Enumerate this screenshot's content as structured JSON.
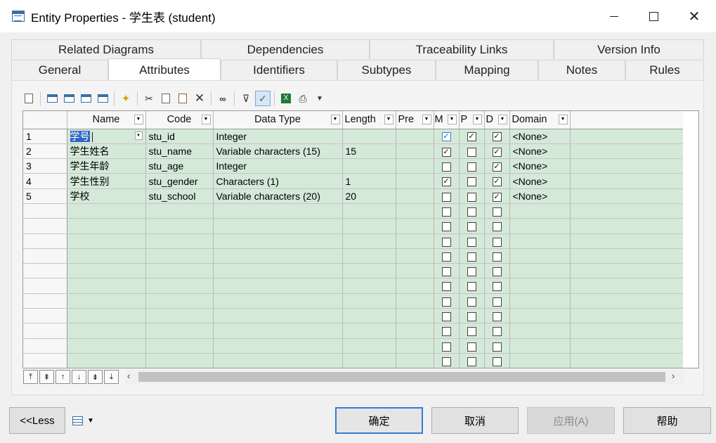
{
  "window": {
    "title": "Entity Properties - 学生表 (student)",
    "minimize_icon": "minimize-icon",
    "maximize_icon": "maximize-icon",
    "close_label": "✕"
  },
  "tabs": {
    "row1": [
      "Related Diagrams",
      "Dependencies",
      "Traceability Links",
      "Version Info"
    ],
    "row2": [
      "General",
      "Attributes",
      "Identifiers",
      "Subtypes",
      "Mapping",
      "Notes",
      "Rules"
    ],
    "active": "Attributes"
  },
  "grid": {
    "columns": [
      "Name",
      "Code",
      "Data Type",
      "Length",
      "Pre",
      "M",
      "P",
      "D",
      "Domain"
    ],
    "rows": [
      {
        "num": "1",
        "name": "学号",
        "code": "stu_id",
        "type": "Integer",
        "length": "",
        "pre": "",
        "m": true,
        "p": true,
        "d": true,
        "domain": "<None>"
      },
      {
        "num": "2",
        "name": "学生姓名",
        "code": "stu_name",
        "type": "Variable characters (15)",
        "length": "15",
        "pre": "",
        "m": true,
        "p": false,
        "d": true,
        "domain": "<None>"
      },
      {
        "num": "3",
        "name": "学生年龄",
        "code": "stu_age",
        "type": "Integer",
        "length": "",
        "pre": "",
        "m": false,
        "p": false,
        "d": true,
        "domain": "<None>"
      },
      {
        "num": "4",
        "name": "学生性别",
        "code": "stu_gender",
        "type": "Characters (1)",
        "length": "1",
        "pre": "",
        "m": true,
        "p": false,
        "d": true,
        "domain": "<None>"
      },
      {
        "num": "5",
        "name": "学校",
        "code": "stu_school",
        "type": "Variable characters (20)",
        "length": "20",
        "pre": "",
        "m": false,
        "p": false,
        "d": true,
        "domain": "<None>"
      }
    ],
    "empty_rows": 11
  },
  "buttons": {
    "less": "<<Less",
    "ok": "确定",
    "cancel": "取消",
    "apply": "应用(A)",
    "help": "帮助"
  },
  "colors": {
    "row_fill": "#d5e9d8",
    "selection": "#2f65c4",
    "default_button_border": "#3a7bd5"
  }
}
